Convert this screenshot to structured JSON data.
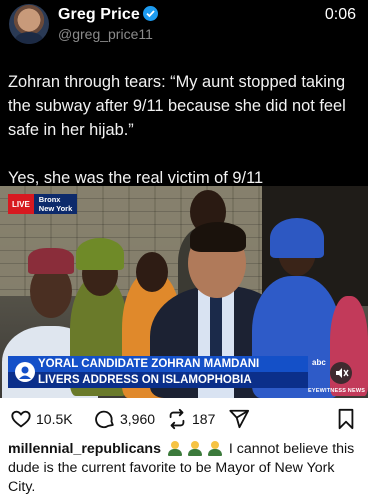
{
  "tweet": {
    "author_name": "Greg Price",
    "handle": "@greg_price11",
    "video_time": "0:06",
    "text_paragraphs": [
      "Zohran through tears: “My aunt stopped taking the subway after 9/11 because she did not feel safe in her hijab.”",
      "Yes, she was the real victim of 9/11"
    ]
  },
  "video": {
    "live_label": "LIVE",
    "location_line1": "Bronx",
    "location_line2": "New York",
    "headline_line1": "YORAL CANDIDATE ZOHRAN MAMDANI",
    "headline_line2": "LIVERS ADDRESS ON ISLAMOPHOBIA",
    "network_logo": "abc",
    "program": "EYEWITNESS NEWS",
    "sound_icon": "mute-icon"
  },
  "post": {
    "likes": "10.5K",
    "comments": "3,960",
    "reposts": "187",
    "caption_user": "millennial_republicans",
    "caption_emojis": [
      "man-farmer",
      "man-farmer",
      "man-farmer"
    ],
    "caption_text": "I cannot believe this dude is the current favorite to be Mayor of New York City."
  },
  "colors": {
    "tweet_bg": "#000000",
    "verified": "#1d9bf0",
    "live_red": "#d71920",
    "lower_third_blue": "#1450c8"
  }
}
